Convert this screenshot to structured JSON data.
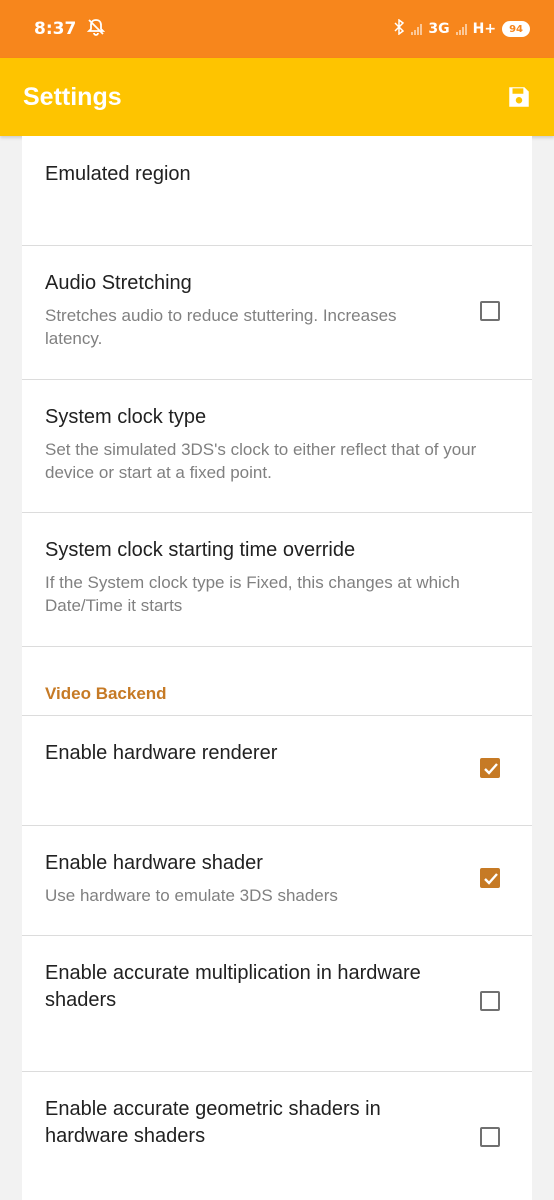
{
  "status_bar": {
    "time": "8:37",
    "network": "3G",
    "network2": "H+",
    "battery": "94",
    "icons": [
      "alarm-off-icon",
      "bluetooth-icon",
      "signal-icon",
      "signal-icon",
      "battery-icon"
    ]
  },
  "app_bar": {
    "title": "Settings",
    "save_icon": "save-icon"
  },
  "settings": [
    {
      "title": "Emulated region",
      "summary": ""
    },
    {
      "title": "Audio Stretching",
      "summary": "Stretches audio to reduce stuttering. Increases latency.",
      "checked": false
    },
    {
      "title": "System clock type",
      "summary": "Set the simulated 3DS's clock to either reflect that of your device or start at a fixed point."
    },
    {
      "title": "System clock starting time override",
      "summary": "If the System clock type is Fixed, this changes at which Date/Time it starts"
    }
  ],
  "section_header": "Video Backend",
  "video_settings": [
    {
      "title": "Enable hardware renderer",
      "summary": "",
      "checked": true
    },
    {
      "title": "Enable hardware shader",
      "summary": "Use hardware to emulate 3DS shaders",
      "checked": true
    },
    {
      "title": "Enable accurate multiplication in hardware shaders",
      "summary": "",
      "checked": false
    },
    {
      "title": "Enable accurate geometric shaders in hardware shaders",
      "summary": "",
      "checked": false
    }
  ],
  "colors": {
    "status_bar": "#f7861c",
    "app_bar": "#fec400",
    "accent": "#c67a25"
  }
}
